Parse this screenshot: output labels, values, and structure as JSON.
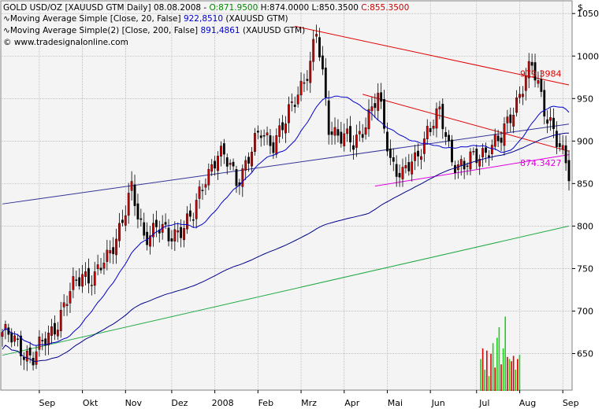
{
  "header": {
    "line1": {
      "instrument": "GOLD USD/OZ [XAUUSD GTM  Daily] 08.08.2008 - ",
      "open": "O:871.9500",
      "high_low": " H:874.0000 L:850.3500 ",
      "close": "C:855.3500"
    },
    "line2": {
      "label": "Moving Average Simple [Close, 20, False] ",
      "value": "922,8510",
      "suffix": " (XAUUSD GTM)"
    },
    "line3": {
      "label": "Moving Average Simple(2) [Close, 200, False] ",
      "value": "891,4861",
      "suffix": " (XAUUSD GTM)"
    },
    "copyright": "© www.tradesignalonline.com"
  },
  "currency_symbol": "$",
  "colors": {
    "up_candle": "#cc0000",
    "down_candle": "#000000",
    "ma20": "#0000cc",
    "ma200": "#00008b",
    "resistance": "#e00000",
    "support": "#e000e0",
    "long_trend": "#22aa44",
    "long_trend2": "#333399",
    "volume_up": "#22cc22",
    "volume_down": "#dd0000",
    "header_green": "#008800",
    "header_red": "#cc0000",
    "header_blue": "#0000cc"
  },
  "chart_data": {
    "type": "candlestick",
    "y_axis": {
      "range": [
        607,
        1065
      ],
      "ticks": [
        650,
        700,
        750,
        800,
        850,
        900,
        950,
        1000,
        1050
      ],
      "side": "right",
      "grid": true
    },
    "x_axis": {
      "ticks": [
        "Sep",
        "Okt",
        "Nov",
        "Dez",
        "2008",
        "Feb",
        "Mrz",
        "Apr",
        "Mai",
        "Jun",
        "Jul",
        "Aug",
        "Sep"
      ],
      "grid": true
    },
    "annotations": [
      {
        "label": "979.3984",
        "value": 979.3984,
        "color": "#e00000"
      },
      {
        "label": "874.3427",
        "value": 874.3427,
        "color": "#e000e0"
      }
    ],
    "price_path": [
      [
        0,
        675
      ],
      [
        5,
        660
      ],
      [
        10,
        645
      ],
      [
        14,
        665
      ],
      [
        18,
        690
      ],
      [
        22,
        720
      ],
      [
        26,
        745
      ],
      [
        30,
        740
      ],
      [
        34,
        760
      ],
      [
        38,
        800
      ],
      [
        42,
        840
      ],
      [
        44,
        810
      ],
      [
        46,
        790
      ],
      [
        50,
        800
      ],
      [
        54,
        785
      ],
      [
        58,
        800
      ],
      [
        62,
        810
      ],
      [
        66,
        860
      ],
      [
        70,
        885
      ],
      [
        74,
        870
      ],
      [
        76,
        855
      ],
      [
        80,
        880
      ],
      [
        84,
        910
      ],
      [
        88,
        900
      ],
      [
        92,
        920
      ],
      [
        96,
        960
      ],
      [
        100,
        990
      ],
      [
        102,
        1025
      ],
      [
        104,
        975
      ],
      [
        106,
        920
      ],
      [
        110,
        905
      ],
      [
        114,
        895
      ],
      [
        118,
        925
      ],
      [
        122,
        950
      ],
      [
        126,
        880
      ],
      [
        130,
        860
      ],
      [
        134,
        875
      ],
      [
        138,
        915
      ],
      [
        142,
        930
      ],
      [
        146,
        880
      ],
      [
        150,
        870
      ],
      [
        154,
        880
      ],
      [
        158,
        895
      ],
      [
        162,
        900
      ],
      [
        166,
        940
      ],
      [
        170,
        975
      ],
      [
        172,
        985
      ],
      [
        174,
        965
      ],
      [
        176,
        940
      ],
      [
        178,
        925
      ],
      [
        180,
        900
      ],
      [
        182,
        880
      ],
      [
        184,
        860
      ]
    ],
    "volume": [
      {
        "value": 30,
        "dir": "up"
      },
      {
        "value": 40,
        "dir": "down"
      },
      {
        "value": 20,
        "dir": "up"
      },
      {
        "value": 38,
        "dir": "down"
      },
      {
        "value": 14,
        "dir": "up"
      },
      {
        "value": 35,
        "dir": "down"
      },
      {
        "value": 45,
        "dir": "up"
      },
      {
        "value": 22,
        "dir": "down"
      },
      {
        "value": 50,
        "dir": "up"
      },
      {
        "value": 60,
        "dir": "up"
      },
      {
        "value": 25,
        "dir": "down"
      },
      {
        "value": 40,
        "dir": "up"
      },
      {
        "value": 70,
        "dir": "up"
      },
      {
        "value": 32,
        "dir": "down"
      },
      {
        "value": 30,
        "dir": "up"
      },
      {
        "value": 28,
        "dir": "down"
      },
      {
        "value": 33,
        "dir": "down"
      },
      {
        "value": 20,
        "dir": "up"
      },
      {
        "value": 30,
        "dir": "down"
      },
      {
        "value": 34,
        "dir": "up"
      }
    ]
  }
}
